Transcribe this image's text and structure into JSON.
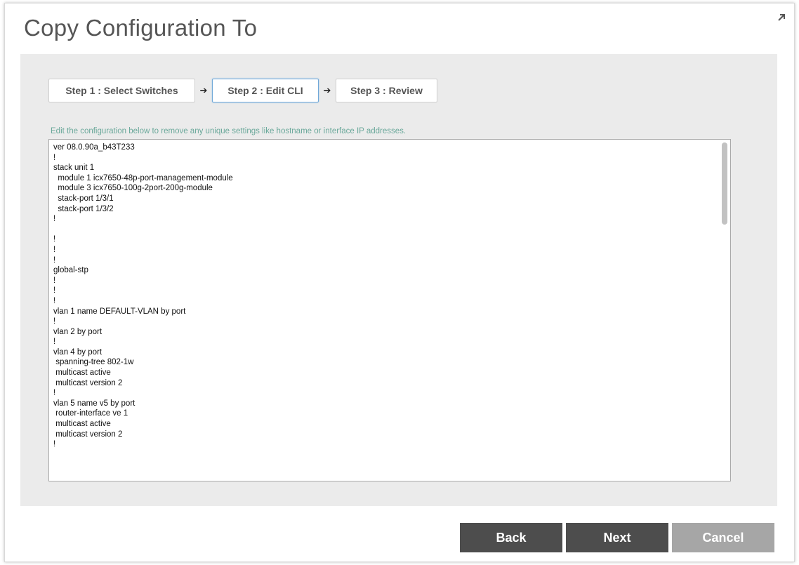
{
  "dialog": {
    "title": "Copy Configuration To",
    "expand_icon": "expand-arrow-icon"
  },
  "wizard": {
    "steps": [
      {
        "label": "Step 1 : Select Switches",
        "active": false
      },
      {
        "label": "Step 2 : Edit CLI",
        "active": true
      },
      {
        "label": "Step 3 : Review",
        "active": false
      }
    ],
    "arrow": "➔"
  },
  "instruction": "Edit the configuration below to remove any unique settings like hostname or interface IP addresses.",
  "editor": {
    "config_text": "ver 08.0.90a_b43T233\n!\nstack unit 1\n  module 1 icx7650-48p-port-management-module\n  module 3 icx7650-100g-2port-200g-module\n  stack-port 1/3/1\n  stack-port 1/3/2\n!\n\n!\n!\n!\nglobal-stp\n!\n!\n!\nvlan 1 name DEFAULT-VLAN by port\n!\nvlan 2 by port\n!\nvlan 4 by port\n spanning-tree 802-1w\n multicast active\n multicast version 2\n!\nvlan 5 name v5 by port\n router-interface ve 1\n multicast active\n multicast version 2\n!"
  },
  "buttons": {
    "back": "Back",
    "next": "Next",
    "cancel": "Cancel"
  }
}
